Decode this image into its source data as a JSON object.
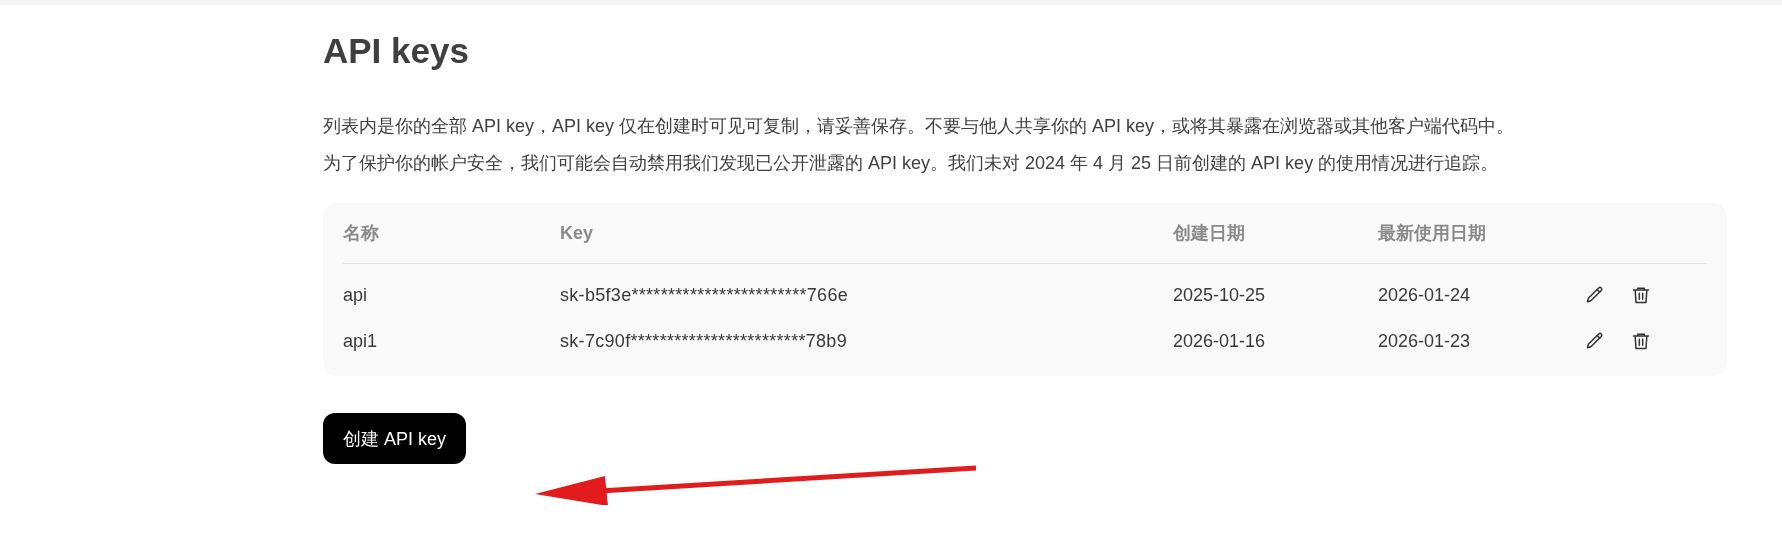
{
  "title": "API keys",
  "description": [
    "列表内是你的全部 API key，API key 仅在创建时可见可复制，请妥善保存。不要与他人共享你的 API key，或将其暴露在浏览器或其他客户端代码中。",
    "为了保护你的帐户安全，我们可能会自动禁用我们发现已公开泄露的 API key。我们未对 2024 年 4 月 25 日前创建的 API key 的使用情况进行追踪。"
  ],
  "table": {
    "columns": [
      "名称",
      "Key",
      "创建日期",
      "最新使用日期"
    ],
    "rows": [
      {
        "name": "api",
        "key": "sk-b5f3e************************766e",
        "created": "2025-10-25",
        "last_used": "2026-01-24"
      },
      {
        "name": "api1",
        "key": "sk-7c90f************************78b9",
        "created": "2026-01-16",
        "last_used": "2026-01-23"
      }
    ]
  },
  "create_button": "创建 API key"
}
